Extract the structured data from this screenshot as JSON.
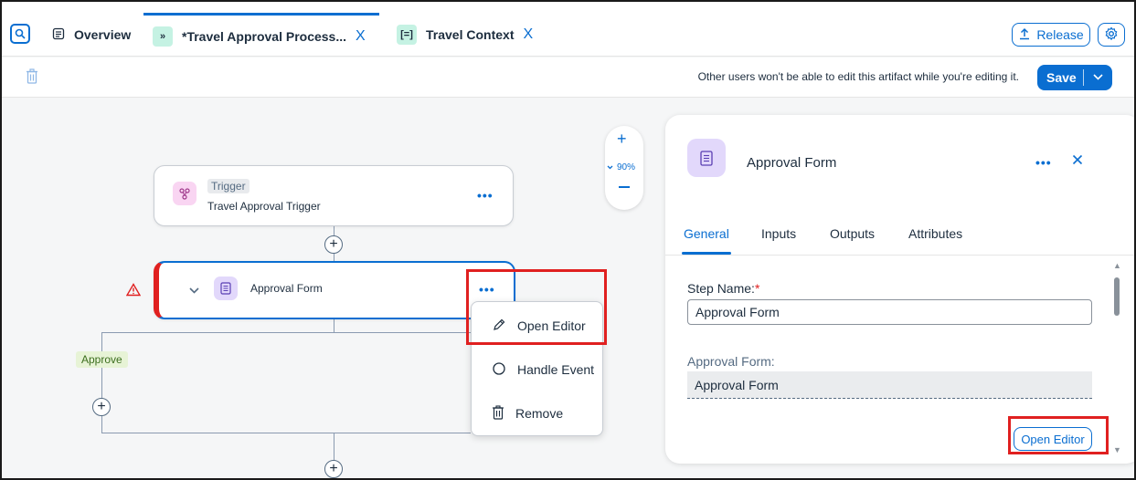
{
  "tabs": {
    "search_icon": "search-icon",
    "overview": "Overview",
    "process": "*Travel Approval Process...",
    "context": "Travel Context",
    "close_glyph": "X"
  },
  "header": {
    "release": "Release"
  },
  "toolbar": {
    "message": "Other users won't be able to edit this artifact while you're editing it.",
    "save": "Save"
  },
  "canvas": {
    "trigger": {
      "badge": "Trigger",
      "name": "Travel Approval Trigger"
    },
    "approval_step": {
      "name": "Approval Form"
    },
    "branch_label": "Approve",
    "zoom": {
      "level": "90%"
    },
    "menu": {
      "items": [
        "Open Editor",
        "Handle Event",
        "Remove"
      ]
    }
  },
  "panel": {
    "title": "Approval Form",
    "tabs": [
      "General",
      "Inputs",
      "Outputs",
      "Attributes"
    ],
    "step_name_label": "Step Name:",
    "required_mark": "*",
    "step_name_value": "Approval Form",
    "approval_form_label": "Approval Form:",
    "approval_form_value": "Approval Form",
    "open_editor": "Open Editor"
  },
  "colors": {
    "accent": "#0a6ed1",
    "highlight": "#e02020",
    "error": "#e02020",
    "approve_bg": "#e7f3d6"
  }
}
